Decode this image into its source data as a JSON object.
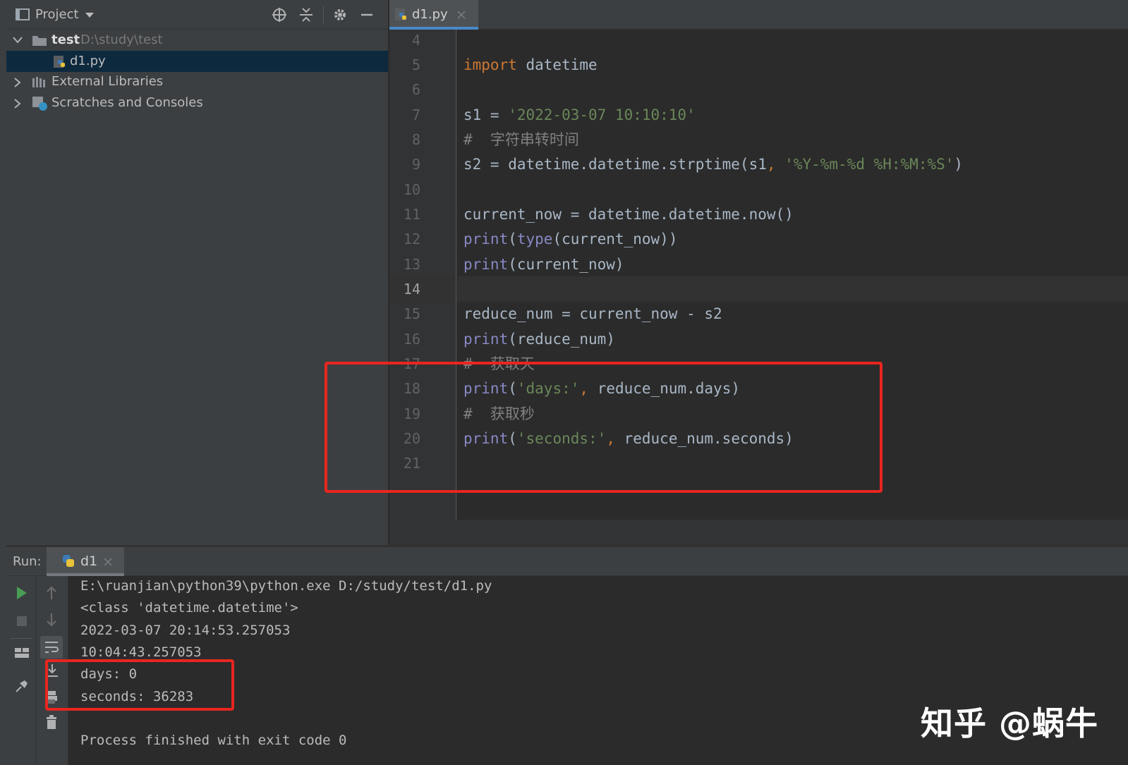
{
  "project_panel": {
    "title": "Project",
    "tree": [
      {
        "label": "test",
        "path": "D:\\study\\test"
      },
      {
        "label": "d1.py"
      },
      {
        "label": "External Libraries"
      },
      {
        "label": "Scratches and Consoles"
      }
    ]
  },
  "editor": {
    "tab_label": "d1.py",
    "lines": [
      {
        "n": "4"
      },
      {
        "n": "5"
      },
      {
        "n": "6"
      },
      {
        "n": "7"
      },
      {
        "n": "8"
      },
      {
        "n": "9"
      },
      {
        "n": "10"
      },
      {
        "n": "11"
      },
      {
        "n": "12"
      },
      {
        "n": "13"
      },
      {
        "n": "14"
      },
      {
        "n": "15"
      },
      {
        "n": "16"
      },
      {
        "n": "17"
      },
      {
        "n": "18"
      },
      {
        "n": "19"
      },
      {
        "n": "20"
      },
      {
        "n": "21"
      }
    ],
    "code": {
      "l5_kw": "import",
      "l5_rest": " datetime",
      "l7_a": "s1 = ",
      "l7_str": "'2022-03-07 10:10:10'",
      "l8": "#  字符串转时间",
      "l9_a": "s2 = datetime.datetime.strptime(s1",
      "l9_comma": ", ",
      "l9_str": "'%Y-%m-%d %H:%M:%S'",
      "l9_end": ")",
      "l11": "current_now = datetime.datetime.now()",
      "l12_bi": "print",
      "l12_a": "(",
      "l12_bi2": "type",
      "l12_b": "(current_now))",
      "l13_bi": "print",
      "l13_a": "(current_now)",
      "l15": "reduce_num = current_now - s2",
      "l16_bi": "print",
      "l16_a": "(reduce_num)",
      "l17": "#  获取天",
      "l18_bi": "print",
      "l18_a": "(",
      "l18_str": "'days:'",
      "l18_comma": ", ",
      "l18_b": "reduce_num.days)",
      "l19": "#  获取秒",
      "l20_bi": "print",
      "l20_a": "(",
      "l20_str": "'seconds:'",
      "l20_comma": ", ",
      "l20_b": "reduce_num.seconds)"
    }
  },
  "run_panel": {
    "label": "Run:",
    "tab_label": "d1",
    "output": [
      "E:\\ruanjian\\python39\\python.exe D:/study/test/d1.py",
      "<class 'datetime.datetime'>",
      "2022-03-07 20:14:53.257053",
      "10:04:43.257053",
      "days: 0",
      "seconds: 36283",
      "",
      "Process finished with exit code 0"
    ]
  },
  "watermark": "知乎 @蜗牛",
  "colors": {
    "keyword": "#cc7832",
    "string": "#6a8759",
    "builtin": "#8888c6",
    "comment": "#808080",
    "highlight_box": "#e8261f",
    "selection": "#0d293e"
  }
}
